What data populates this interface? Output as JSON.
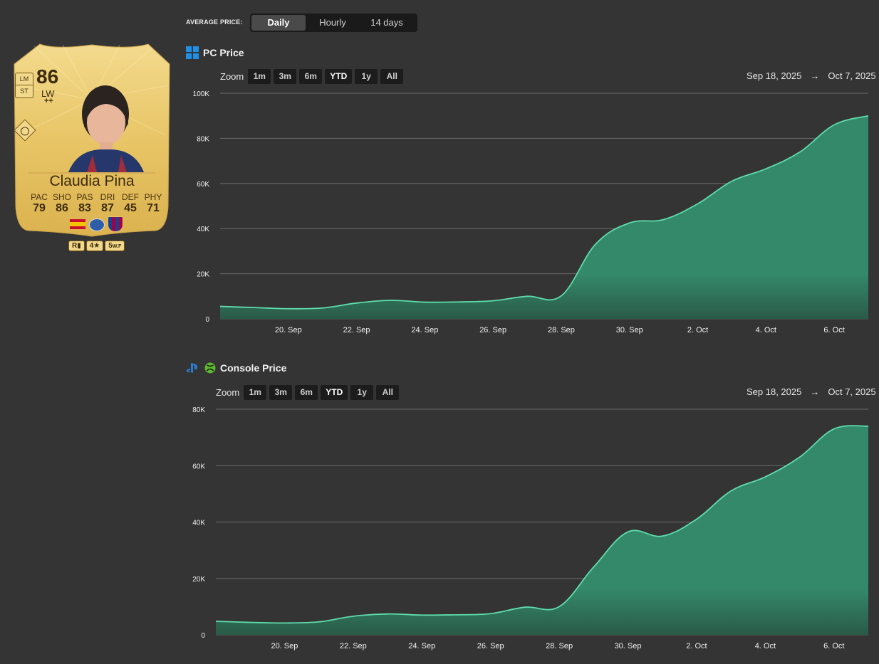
{
  "tabs": {
    "label": "AVERAGE PRICE:",
    "items": [
      {
        "label": "Daily",
        "active": true
      },
      {
        "label": "Hourly",
        "active": false
      },
      {
        "label": "14 days",
        "active": false
      }
    ]
  },
  "card": {
    "rating": "86",
    "position": "LW",
    "position_plus": "++",
    "alt_positions": [
      "LM",
      "ST"
    ],
    "name": "Claudia Pina",
    "stats": [
      {
        "label": "PAC",
        "value": "79"
      },
      {
        "label": "SHO",
        "value": "86"
      },
      {
        "label": "PAS",
        "value": "83"
      },
      {
        "label": "DRI",
        "value": "87"
      },
      {
        "label": "DEF",
        "value": "45"
      },
      {
        "label": "PHY",
        "value": "71"
      }
    ],
    "badges": {
      "foot": "R",
      "skill": "4★",
      "weak_foot": "5",
      "weak_foot_suffix": "W.F"
    },
    "nation_icon": "spain-flag-icon",
    "league_icon": "liga-f-icon",
    "club_icon": "fc-barcelona-crest-icon",
    "card_color": "#e9c46a"
  },
  "pc": {
    "title": "PC Price",
    "icon": "windows-icon",
    "zoom_label": "Zoom",
    "zoom_buttons": [
      {
        "label": "1m",
        "active": false
      },
      {
        "label": "3m",
        "active": false
      },
      {
        "label": "6m",
        "active": false
      },
      {
        "label": "YTD",
        "active": true
      },
      {
        "label": "1y",
        "active": false
      },
      {
        "label": "All",
        "active": false
      }
    ],
    "range_from": "Sep 18, 2025",
    "range_arrow": "→",
    "range_to": "Oct 7, 2025"
  },
  "console": {
    "title": "Console Price",
    "icons": [
      "playstation-icon",
      "xbox-icon"
    ],
    "zoom_label": "Zoom",
    "zoom_buttons": [
      {
        "label": "1m",
        "active": false
      },
      {
        "label": "3m",
        "active": false
      },
      {
        "label": "6m",
        "active": false
      },
      {
        "label": "YTD",
        "active": true
      },
      {
        "label": "1y",
        "active": false
      },
      {
        "label": "All",
        "active": false
      }
    ],
    "range_from": "Sep 18, 2025",
    "range_arrow": "→",
    "range_to": "Oct 7, 2025"
  },
  "colors": {
    "line": "#5fdcae",
    "fill": "#34896a",
    "grid": "#6a6a6a",
    "background": "#343434"
  },
  "chart_data": [
    {
      "type": "area",
      "title": "PC Price",
      "x": [
        "Sep 18",
        "Sep 19",
        "Sep 20",
        "Sep 21",
        "Sep 22",
        "Sep 23",
        "Sep 24",
        "Sep 25",
        "Sep 26",
        "Sep 27",
        "Sep 28",
        "Sep 29",
        "Sep 30",
        "Oct 1",
        "Oct 2",
        "Oct 3",
        "Oct 4",
        "Oct 5",
        "Oct 6",
        "Oct 7"
      ],
      "x_tick_labels": [
        "20. Sep",
        "22. Sep",
        "24. Sep",
        "26. Sep",
        "28. Sep",
        "30. Sep",
        "2. Oct",
        "4. Oct",
        "6. Oct"
      ],
      "y_tick_labels": [
        "0",
        "20K",
        "40K",
        "60K",
        "80K",
        "100K"
      ],
      "ylim": [
        0,
        100000
      ],
      "values": [
        5500,
        5000,
        4500,
        4800,
        7000,
        8200,
        7400,
        7500,
        8000,
        10000,
        10200,
        33000,
        42500,
        44000,
        51000,
        61000,
        66500,
        74000,
        86000,
        90000
      ],
      "grid": true
    },
    {
      "type": "area",
      "title": "Console Price",
      "x": [
        "Sep 18",
        "Sep 19",
        "Sep 20",
        "Sep 21",
        "Sep 22",
        "Sep 23",
        "Sep 24",
        "Sep 25",
        "Sep 26",
        "Sep 27",
        "Sep 28",
        "Sep 29",
        "Sep 30",
        "Oct 1",
        "Oct 2",
        "Oct 3",
        "Oct 4",
        "Oct 5",
        "Oct 6",
        "Oct 7"
      ],
      "x_tick_labels": [
        "20. Sep",
        "22. Sep",
        "24. Sep",
        "26. Sep",
        "28. Sep",
        "30. Sep",
        "2. Oct",
        "4. Oct",
        "6. Oct"
      ],
      "y_tick_labels": [
        "0",
        "20K",
        "40K",
        "60K",
        "80K"
      ],
      "ylim": [
        0,
        80000
      ],
      "values": [
        4800,
        4400,
        4200,
        4600,
        6600,
        7400,
        7000,
        7100,
        7500,
        9800,
        10000,
        24000,
        36500,
        35000,
        41000,
        51000,
        56000,
        63000,
        73000,
        74000
      ],
      "grid": true
    }
  ]
}
